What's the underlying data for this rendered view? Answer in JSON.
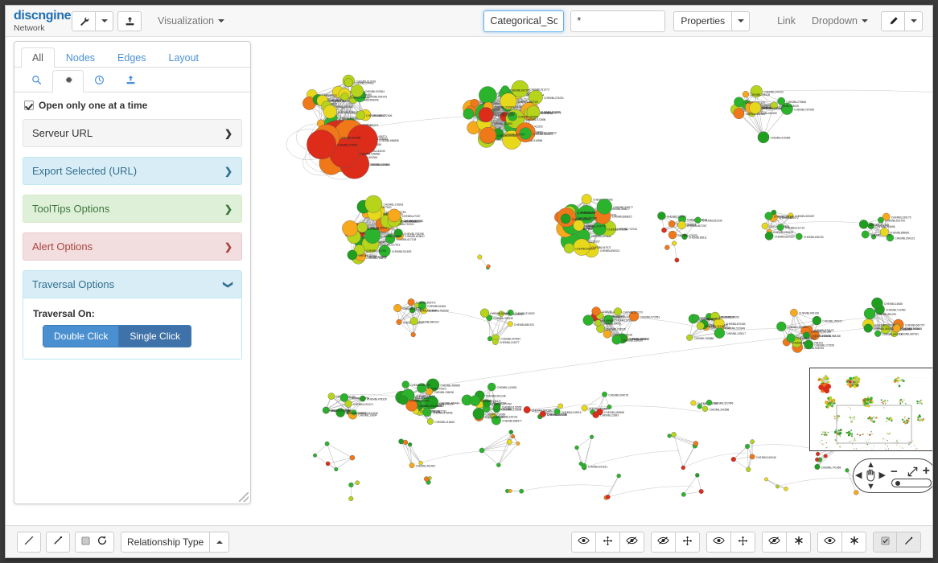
{
  "app": {
    "logo_main": "discngine",
    "logo_sub": "Network"
  },
  "topbar": {
    "tools_icon": "wrench-icon",
    "export_icon": "export-icon",
    "visualization_label": "Visualization",
    "name_input_value": "Categorical_Solubilit",
    "filter_input_value": "*",
    "properties_label": "Properties",
    "link_label": "Link",
    "dropdown_label": "Dropdown",
    "edit_icon": "edit-pencil-icon"
  },
  "panel": {
    "tabs": [
      {
        "label": "All",
        "active": true
      },
      {
        "label": "Nodes",
        "active": false
      },
      {
        "label": "Edges",
        "active": false
      },
      {
        "label": "Layout",
        "active": false
      }
    ],
    "icon_tabs": [
      {
        "icon": "search-icon",
        "active": false
      },
      {
        "icon": "gear-icon",
        "active": true
      },
      {
        "icon": "clock-icon",
        "active": false
      },
      {
        "icon": "export-icon",
        "active": false
      }
    ],
    "checkbox": {
      "label": "Open only one at a time",
      "checked": true
    },
    "sections": [
      {
        "label": "Serveur URL",
        "style": "default",
        "open": false,
        "arrow": "❯"
      },
      {
        "label": "Export Selected (URL)",
        "style": "info",
        "open": false,
        "arrow": "❯"
      },
      {
        "label": "ToolTips Options",
        "style": "success",
        "open": false,
        "arrow": "❯"
      },
      {
        "label": "Alert Options",
        "style": "danger",
        "open": false,
        "arrow": "❯"
      },
      {
        "label": "Traversal Options",
        "style": "info",
        "open": true,
        "arrow": "❯"
      }
    ],
    "traversal": {
      "body_label": "Traversal On:",
      "option_a": "Double Click",
      "option_b": "Single Click",
      "selected": "Single Click"
    }
  },
  "bottombar": {
    "left_buttons": [
      {
        "name": "edge-expand-button",
        "icon": "diagonal-arrows-icon"
      },
      {
        "name": "edge-line-button",
        "icon": "diagonal-line-icon"
      }
    ],
    "refresh_group": {
      "checkbox_icon": "square-checkbox-icon",
      "refresh_icon": "refresh-icon"
    },
    "relationship_dropdown": {
      "label": "Relationship Type",
      "caret": "caret-up-icon"
    },
    "right_groups": [
      {
        "name": "node-visibility-group",
        "icons": [
          "eye-icon",
          "move-arrows-icon",
          "eye-slash-icon"
        ]
      },
      {
        "name": "edge-visibility-group",
        "icons": [
          "eye-slash-icon",
          "move-arrows-icon"
        ]
      },
      {
        "name": "label-visibility-group",
        "icons": [
          "eye-icon",
          "move-arrows-icon"
        ]
      },
      {
        "name": "hide-star-group",
        "icons": [
          "eye-slash-icon",
          "asterisk-icon"
        ]
      },
      {
        "name": "show-star-group",
        "icons": [
          "eye-icon",
          "asterisk-icon"
        ]
      },
      {
        "name": "select-pick-group",
        "icons": [
          "square-checkbox-icon",
          "pin-icon"
        ]
      }
    ]
  },
  "zoom_control": {
    "pan_icon": "hand-pan-icon",
    "up_icon": "chevron-up-icon",
    "down_icon": "chevron-down-icon",
    "left_icon": "chevron-left-icon",
    "right_icon": "chevron-right-icon",
    "zoom_out_label": "−",
    "zoom_in_label": "+",
    "fit_icon": "fit-screen-icon",
    "slider_value": 12
  },
  "graph": {
    "node_label_prefix": "CHEMBL",
    "colors": {
      "red": "#dd2c1a",
      "orange": "#f07818",
      "orange_light": "#f7a81b",
      "yellow": "#e8d81c",
      "yellow_green": "#b6d41a",
      "green": "#2bb32b",
      "green_dark": "#1f9e1f",
      "edge": "#9a9a9a"
    },
    "minimap": {
      "viewport_visible": true
    }
  }
}
